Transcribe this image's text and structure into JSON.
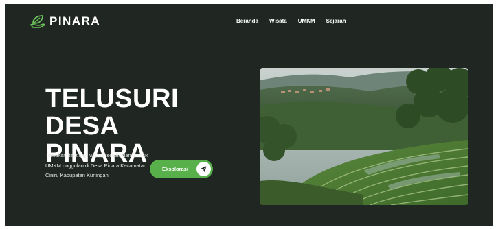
{
  "brand": {
    "name": "PINARA",
    "logo_icon": "leaf-hand-icon"
  },
  "nav": {
    "items": [
      "Beranda",
      "Wisata",
      "UMKM",
      "Sejarah"
    ]
  },
  "hero": {
    "title_line1": "TELUSURI DESA",
    "title_line2": "PINARA",
    "description": "Temukan destinasi wisata terbaik dan produk UMKM unggulan di Desa Pinara Kecamatan Ciniru Kabupaten Kuningan",
    "cta_label": "Eksplorasi",
    "cta_icon": "paper-plane-icon",
    "image_subject": "rice-terraces-photo"
  },
  "colors": {
    "background": "#202722",
    "accent": "#58b04a",
    "text": "#ffffff"
  }
}
